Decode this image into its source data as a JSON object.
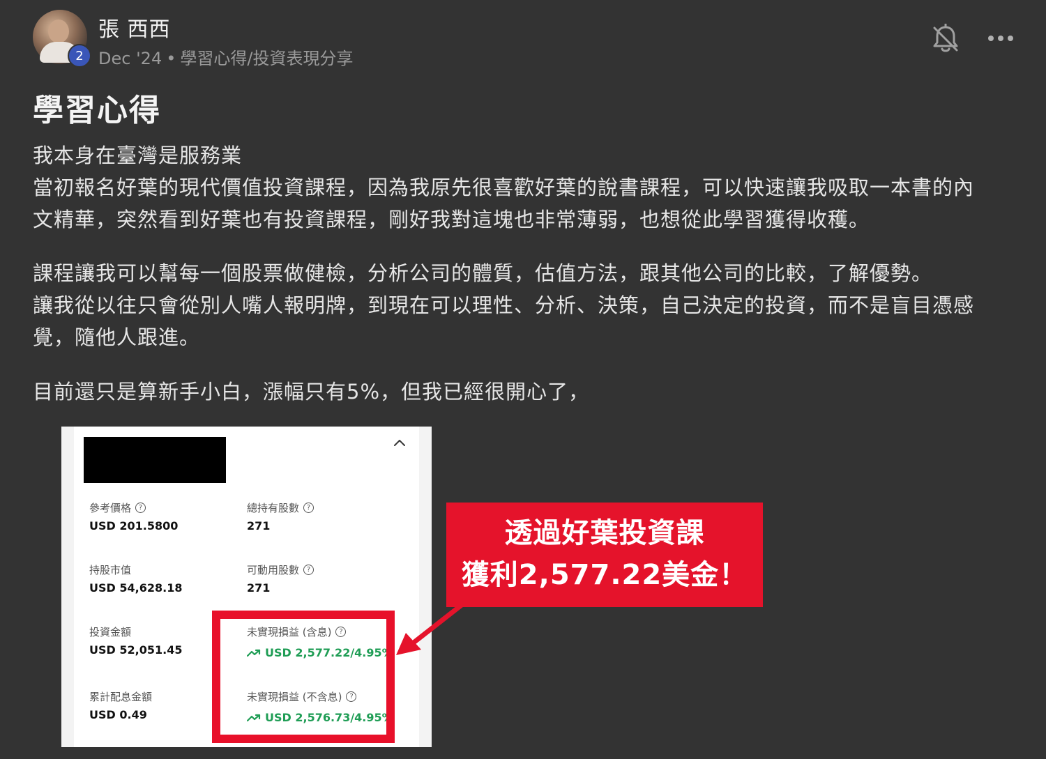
{
  "post": {
    "author": "張 西西",
    "badge_count": "2",
    "date": "Dec '24",
    "separator": "•",
    "category": "學習心得/投資表現分享",
    "title": "學習心得",
    "paragraphs": [
      [
        "我本身在臺灣是服務業",
        "當初報名好葉的現代價值投資課程，因為我原先很喜歡好葉的說書課程，可以快速讓我吸取一本書的內",
        "文精華，突然看到好葉也有投資課程，剛好我對這塊也非常薄弱，也想從此學習獲得收穫。"
      ],
      [
        "課程讓我可以幫每一個股票做健檢，分析公司的體質，估值方法，跟其他公司的比較，了解優勢。",
        "讓我從以往只會從別人嘴人報明牌，到現在可以理性、分析、決策，自己決定的投資，而不是盲目憑感",
        "覺，隨他人跟進。"
      ],
      [
        "目前還只是算新手小白，漲幅只有5%，但我已經很開心了，"
      ]
    ]
  },
  "icons": {
    "bell": "bell-muted-icon",
    "more": "more-horizontal-icon",
    "collapse": "chevron-up-icon",
    "help": "question-circle-icon",
    "trend": "trend-up-icon"
  },
  "holding": {
    "reference_price": {
      "label": "參考價格",
      "value": "USD 201.5800"
    },
    "total_shares": {
      "label": "總持有股數",
      "value": "271"
    },
    "market_value": {
      "label": "持股市值",
      "value": "USD 54,628.18"
    },
    "available_shares": {
      "label": "可動用股數",
      "value": "271"
    },
    "invested": {
      "label": "投資金額",
      "value": "USD 52,051.45"
    },
    "unrealized_incl": {
      "label": "未實現損益 (含息)",
      "value": "USD 2,577.22/4.95%"
    },
    "dividends": {
      "label": "累計配息金額",
      "value": "USD 0.49"
    },
    "unrealized_excl": {
      "label": "未實現損益 (不含息)",
      "value": "USD 2,576.73/4.95%"
    }
  },
  "callout": {
    "line1": "透過好葉投資課",
    "line2": "獲利2,577.22美金！"
  },
  "colors": {
    "background": "#333333",
    "accent_red": "#e5132b",
    "gain_green": "#1f9d55",
    "badge_blue": "#3a56b8"
  }
}
